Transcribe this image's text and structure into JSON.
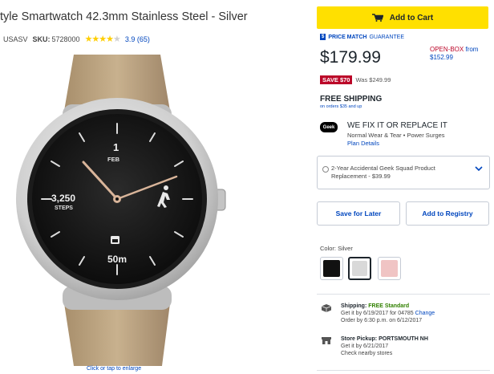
{
  "product": {
    "title": "tyle Smartwatch 42.3mm Stainless Steel - Silver",
    "model_value": "USASV",
    "sku_label": "SKU:",
    "sku_value": "5728000",
    "rating": 3.9,
    "rating_text": "3.9 (65)",
    "enlarge_text": "Click or tap to enlarge"
  },
  "watch_face": {
    "hour": "1",
    "month": "FEB",
    "steps_value": "3,250",
    "steps_label": "STEPS",
    "distance": "50m"
  },
  "buy_box": {
    "add_to_cart_label": "Add to Cart",
    "price_match_badge": "$",
    "price_match_strong": "PRICE MATCH",
    "price_match_light": "GUARANTEE",
    "price": "$179.99",
    "open_box_label": "OPEN-BOX",
    "open_box_from": "from",
    "open_box_price": "$152.99",
    "save_badge": "SAVE $70",
    "was_price": "Was $249.99",
    "free_shipping": "FREE SHIPPING",
    "free_shipping_sub": "on orders $35 and up",
    "geek_logo": "Geek",
    "geek_title": "WE FIX IT OR REPLACE IT",
    "geek_sub": "Normal Wear & Tear • Power Surges",
    "geek_link": "Plan Details",
    "warranty_text": "2-Year Accidental Geek Squad Product Replacement - $39.99",
    "save_for_later": "Save for Later",
    "add_to_registry": "Add to Registry",
    "color_label": "Color: Silver",
    "colors": {
      "black": "#111111",
      "silver": "#d9d9d9",
      "rose": "#f0c4c4"
    }
  },
  "fulfillment": {
    "shipping_label": "Shipping:",
    "shipping_value": "FREE Standard",
    "shipping_line2_pre": "Get it by 6/19/2017 for 04785",
    "shipping_change": "Change",
    "shipping_line3": "Order by 6:30 p.m. on 6/12/2017",
    "pickup_label": "Store Pickup:",
    "pickup_store": "PORTSMOUTH NH",
    "pickup_line2": "Get it by 6/21/2017",
    "pickup_link": "Check nearby stores"
  },
  "colors": {
    "cart_yellow": "#ffe000",
    "link_blue": "#0046be",
    "sale_red": "#bb0628",
    "free_green": "#318000"
  }
}
